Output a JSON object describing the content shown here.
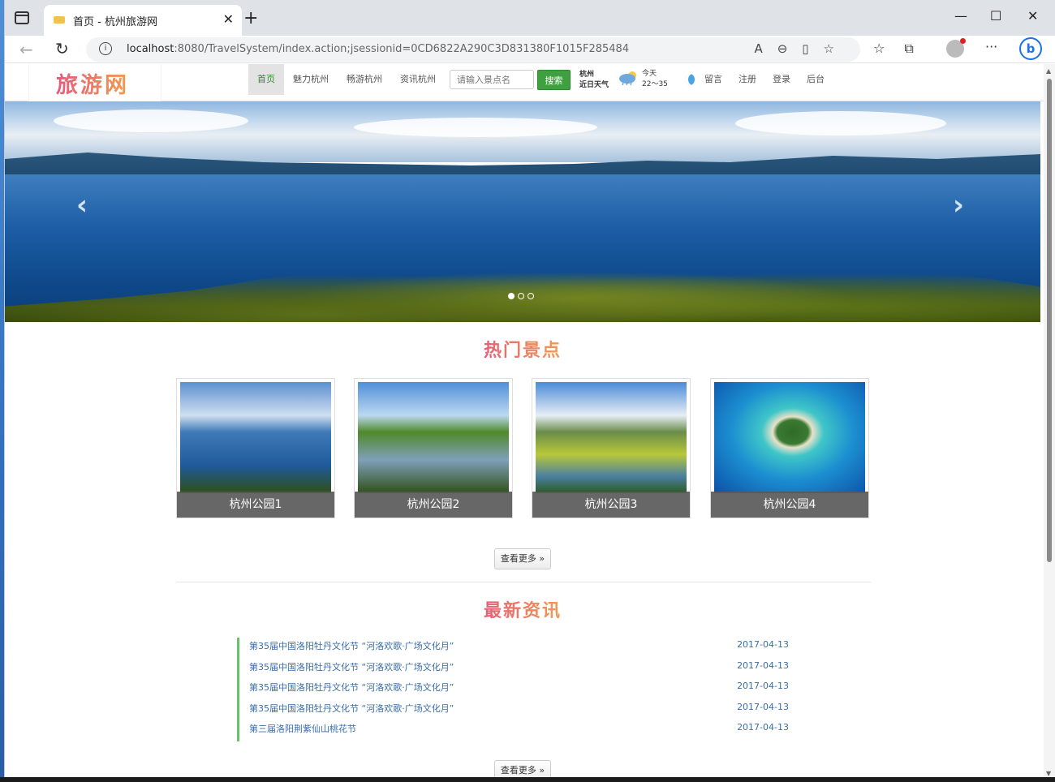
{
  "browser": {
    "tab_title": "首页 - 杭州旅游网",
    "tab_close": "✕",
    "new_tab": "+",
    "url_host": "localhost",
    "url_rest": ":8080/TravelSystem/index.action;jsessionid=0CD6822A290C3D831380F1015F285484",
    "minimize": "—",
    "maximize": "☐",
    "close": "✕",
    "back": "←",
    "reload": "↻",
    "more": "···",
    "bing": "b"
  },
  "site": {
    "logo": "旅游网",
    "nav": [
      "首页",
      "魅力杭州",
      "畅游杭州",
      "资讯杭州"
    ],
    "search_placeholder": "请输入景点名",
    "search_button": "搜索",
    "weather_city": "杭州",
    "weather_label": "近日天气",
    "weather_day": "今天",
    "weather_range": "22～35",
    "nav_right": [
      "留言",
      "注册",
      "登录",
      "后台"
    ]
  },
  "hero": {
    "prev": "‹",
    "next": "›",
    "slide_count": 3,
    "active_slide": 1
  },
  "hot": {
    "title": "热门景点",
    "cards": [
      {
        "caption": "杭州公园1"
      },
      {
        "caption": "杭州公园2"
      },
      {
        "caption": "杭州公园3"
      },
      {
        "caption": "杭州公园4"
      }
    ],
    "more": "查看更多 »"
  },
  "news": {
    "title": "最新资讯",
    "items": [
      {
        "title": "第35届中国洛阳牡丹文化节 “河洛欢歌·广场文化月”",
        "date": "2017-04-13"
      },
      {
        "title": "第35届中国洛阳牡丹文化节 “河洛欢歌·广场文化月”",
        "date": "2017-04-13"
      },
      {
        "title": "第35届中国洛阳牡丹文化节 “河洛欢歌·广场文化月”",
        "date": "2017-04-13"
      },
      {
        "title": "第35届中国洛阳牡丹文化节 “河洛欢歌·广场文化月”",
        "date": "2017-04-13"
      },
      {
        "title": "第三届洛阳荆紫仙山桃花节",
        "date": "2017-04-13"
      }
    ],
    "more": "查看更多 »"
  }
}
